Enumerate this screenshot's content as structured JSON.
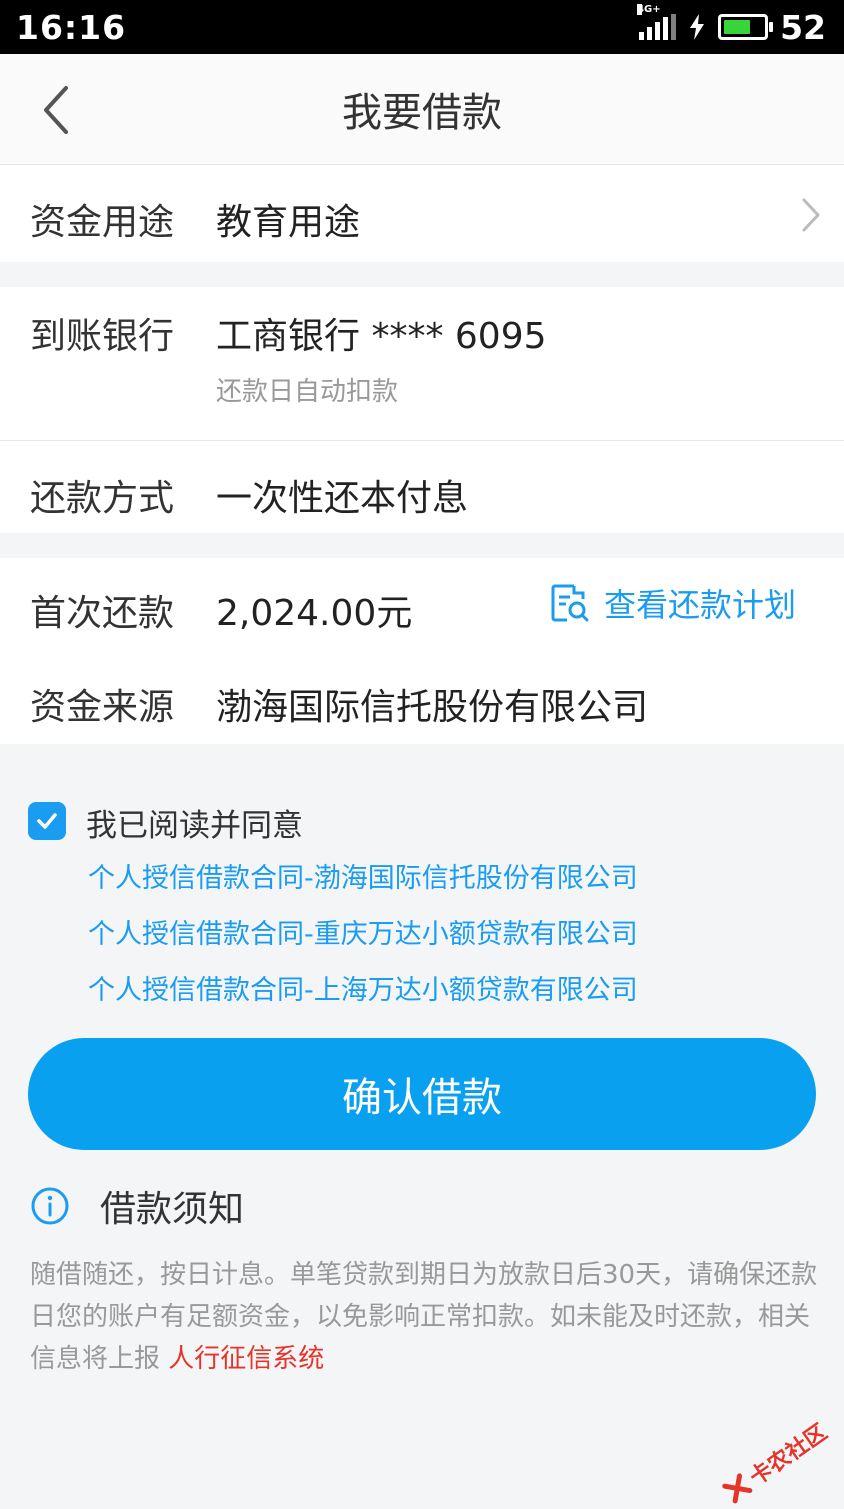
{
  "status_bar": {
    "time": "16:16",
    "network": "4G+",
    "battery": "52"
  },
  "nav": {
    "title": "我要借款"
  },
  "purpose": {
    "label": "资金用途",
    "value": "教育用途"
  },
  "bank": {
    "label": "到账银行",
    "value": "工商银行 **** 6095",
    "sub": "还款日自动扣款"
  },
  "repay_method": {
    "label": "还款方式",
    "value": "一次性还本付息"
  },
  "first_repay": {
    "label": "首次还款",
    "value": "2,024.00元",
    "plan_link": "查看还款计划"
  },
  "funding": {
    "label": "资金来源",
    "value": "渤海国际信托股份有限公司"
  },
  "agreement": {
    "text": "我已阅读并同意",
    "checked": true,
    "contracts": [
      "个人授信借款合同-渤海国际信托股份有限公司",
      "个人授信借款合同-重庆万达小额贷款有限公司",
      "个人授信借款合同-上海万达小额贷款有限公司"
    ]
  },
  "confirm_button": "确认借款",
  "notice": {
    "title": "借款须知",
    "body": "随借随还，按日计息。单笔贷款到期日为放款日后30天，请确保还款日您的账户有足额资金，以免影响正常扣款。如未能及时还款，相关信息将上报 ",
    "highlight": "人行征信系统"
  },
  "watermark": "卡农社区",
  "colors": {
    "accent": "#1a9cf0",
    "button": "#0aa0f0",
    "highlight": "#e5352b"
  }
}
